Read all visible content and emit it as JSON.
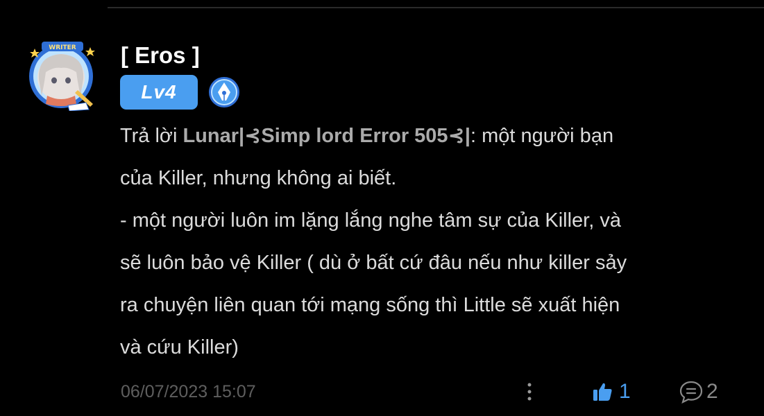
{
  "post": {
    "author": {
      "name": "[ Eros ]",
      "level": "Lv4",
      "frame_label": "WRITER",
      "avatar": "writer-frame-avatar",
      "role_icon": "pen-nib-icon"
    },
    "comment": {
      "reply_prefix": "Trả lời ",
      "reply_to": "Lunar|⊰Simp lord Error 505⊰|",
      "first_line_rest": ": một người bạn",
      "lines": [
        "của Killer, nhưng không ai biết.",
        "- một người luôn im lặng lắng nghe tâm sự của Killer, và",
        "sẽ luôn bảo vệ Killer ( dù ở bất cứ đâu nếu như killer sảy",
        "ra chuyện liên quan tới mạng sống thì Little sẽ xuất hiện",
        "và cứu Killer)"
      ]
    },
    "timestamp": "06/07/2023 15:07",
    "actions": {
      "more_icon": "vertical-dots-icon",
      "like_icon": "thumbs-up-icon",
      "like_count": "1",
      "comment_icon": "comment-bubble-icon",
      "comment_count": "2"
    }
  },
  "colors": {
    "background": "#000000",
    "accent": "#4a9ef0",
    "text": "#dcdcdc",
    "muted": "#5e5e5e",
    "divider": "#2a2a2a"
  }
}
